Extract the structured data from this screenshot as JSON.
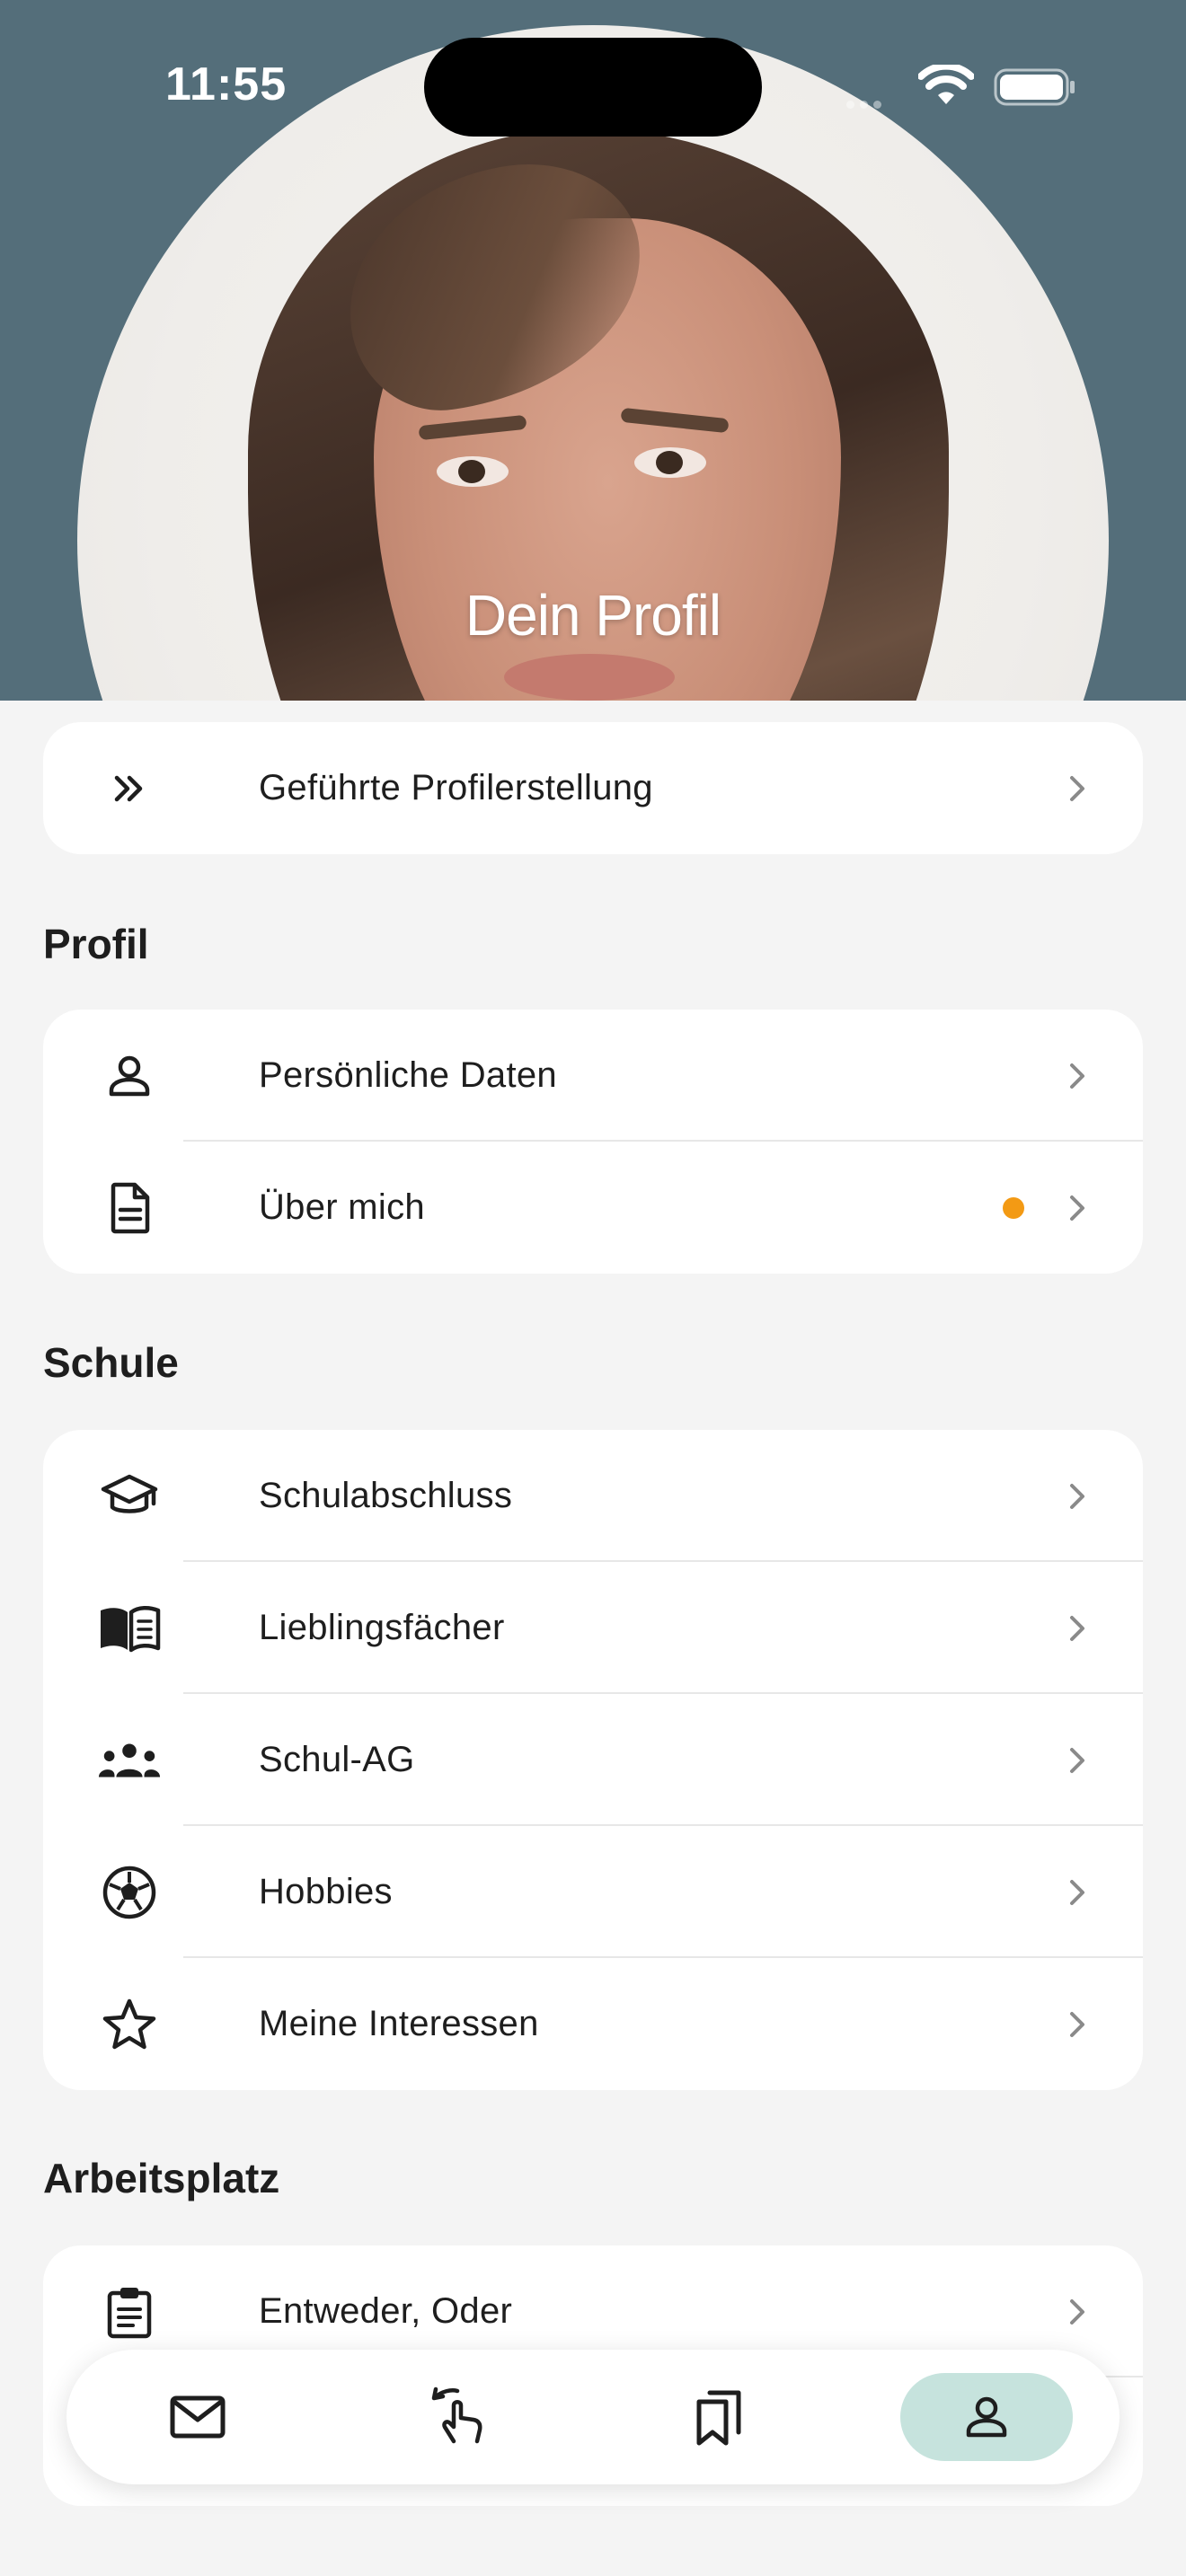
{
  "status_bar": {
    "time": "11:55"
  },
  "header": {
    "title": "Dein Profil"
  },
  "guided": {
    "label": "Geführte Profilerstellung",
    "icon": "double-chevron-right-icon"
  },
  "sections": {
    "profil": {
      "title": "Profil",
      "items": [
        {
          "label": "Persönliche Daten",
          "icon": "person-icon"
        },
        {
          "label": "Über mich",
          "icon": "document-icon",
          "badge_color": "#f39a14"
        }
      ]
    },
    "schule": {
      "title": "Schule",
      "items": [
        {
          "label": "Schulabschluss",
          "icon": "graduation-cap-icon"
        },
        {
          "label": "Lieblingsfächer",
          "icon": "open-book-icon"
        },
        {
          "label": "Schul-AG",
          "icon": "group-icon"
        },
        {
          "label": "Hobbies",
          "icon": "soccer-ball-icon"
        },
        {
          "label": "Meine Interessen",
          "icon": "star-icon"
        }
      ]
    },
    "arbeitsplatz": {
      "title": "Arbeitsplatz",
      "items": [
        {
          "label": "Entweder, Oder",
          "icon": "clipboard-icon"
        }
      ]
    }
  },
  "tabbar": {
    "tabs": [
      {
        "icon": "mail-icon",
        "active": false
      },
      {
        "icon": "swipe-hand-icon",
        "active": false
      },
      {
        "icon": "bookmarks-icon",
        "active": false
      },
      {
        "icon": "profile-icon",
        "active": true
      }
    ],
    "active_color": "#c6e3dd"
  },
  "colors": {
    "header_bg": "#546e7a",
    "page_bg": "#f4f4f4",
    "badge": "#f39a14"
  }
}
